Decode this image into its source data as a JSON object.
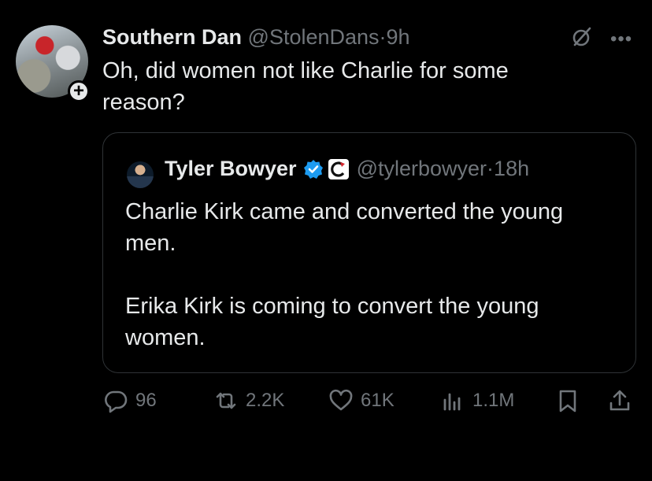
{
  "post": {
    "display_name": "Southern Dan",
    "handle": "@StolenDans",
    "separator": "·",
    "time": "9h",
    "text": "Oh, did women not like Charlie for some reason?"
  },
  "quoted": {
    "display_name": "Tyler Bowyer",
    "handle": "@tylerbowyer",
    "separator": "·",
    "time": "18h",
    "paragraphs": [
      "Charlie Kirk came and converted the young men.",
      "Erika Kirk is coming to convert the young women."
    ]
  },
  "actions": {
    "replies": "96",
    "reposts": "2.2K",
    "likes": "61K",
    "views": "1.1M"
  },
  "icons": {
    "grok": "grok-icon",
    "more": "more-horizontal-icon",
    "follow": "plus-icon",
    "verified": "verified-badge-icon",
    "affiliate": "affiliate-badge-icon",
    "reply": "reply-icon",
    "repost": "repost-icon",
    "like": "heart-icon",
    "views": "views-icon",
    "bookmark": "bookmark-icon",
    "share": "share-icon"
  },
  "colors": {
    "background": "#000000",
    "text": "#e7e9ea",
    "muted": "#71767b",
    "verified": "#1d9bf0",
    "border": "#2f3336"
  }
}
